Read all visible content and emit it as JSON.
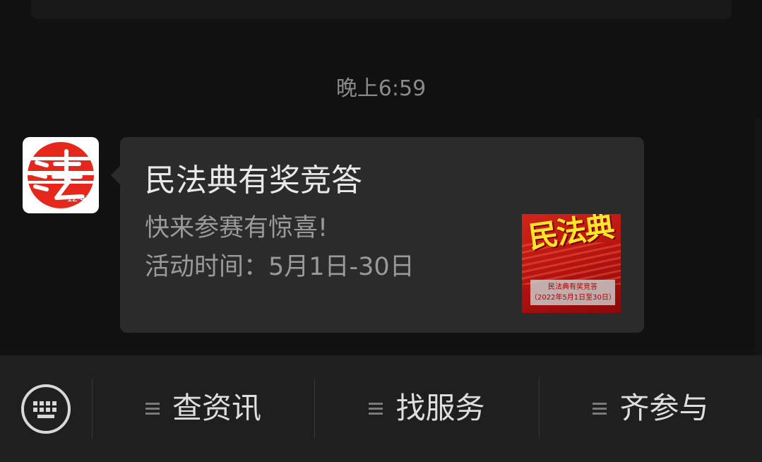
{
  "chat": {
    "timestamp": "晚上6:59"
  },
  "message": {
    "title": "民法典有奖竞答",
    "description_lines": [
      "快来参赛有惊喜!",
      "活动时间：5月1日-30日"
    ],
    "avatar": {
      "icon": "fa-logo-icon",
      "text": "12·4"
    },
    "thumbnail": {
      "headline": "民法典",
      "caption_line1": "民法典有奖竞答",
      "caption_line2": "（2022年5月1日至30日）"
    }
  },
  "bottom_bar": {
    "keyboard_icon": "keyboard-icon",
    "menus": [
      {
        "label": "查资讯",
        "icon": "menu-lines-icon"
      },
      {
        "label": "找服务",
        "icon": "menu-lines-icon"
      },
      {
        "label": "齐参与",
        "icon": "menu-lines-icon"
      }
    ]
  },
  "colors": {
    "background": "#111111",
    "bubble": "#2b2b2b",
    "bar": "#1f1f1f",
    "logo_red": "#e6281c"
  }
}
